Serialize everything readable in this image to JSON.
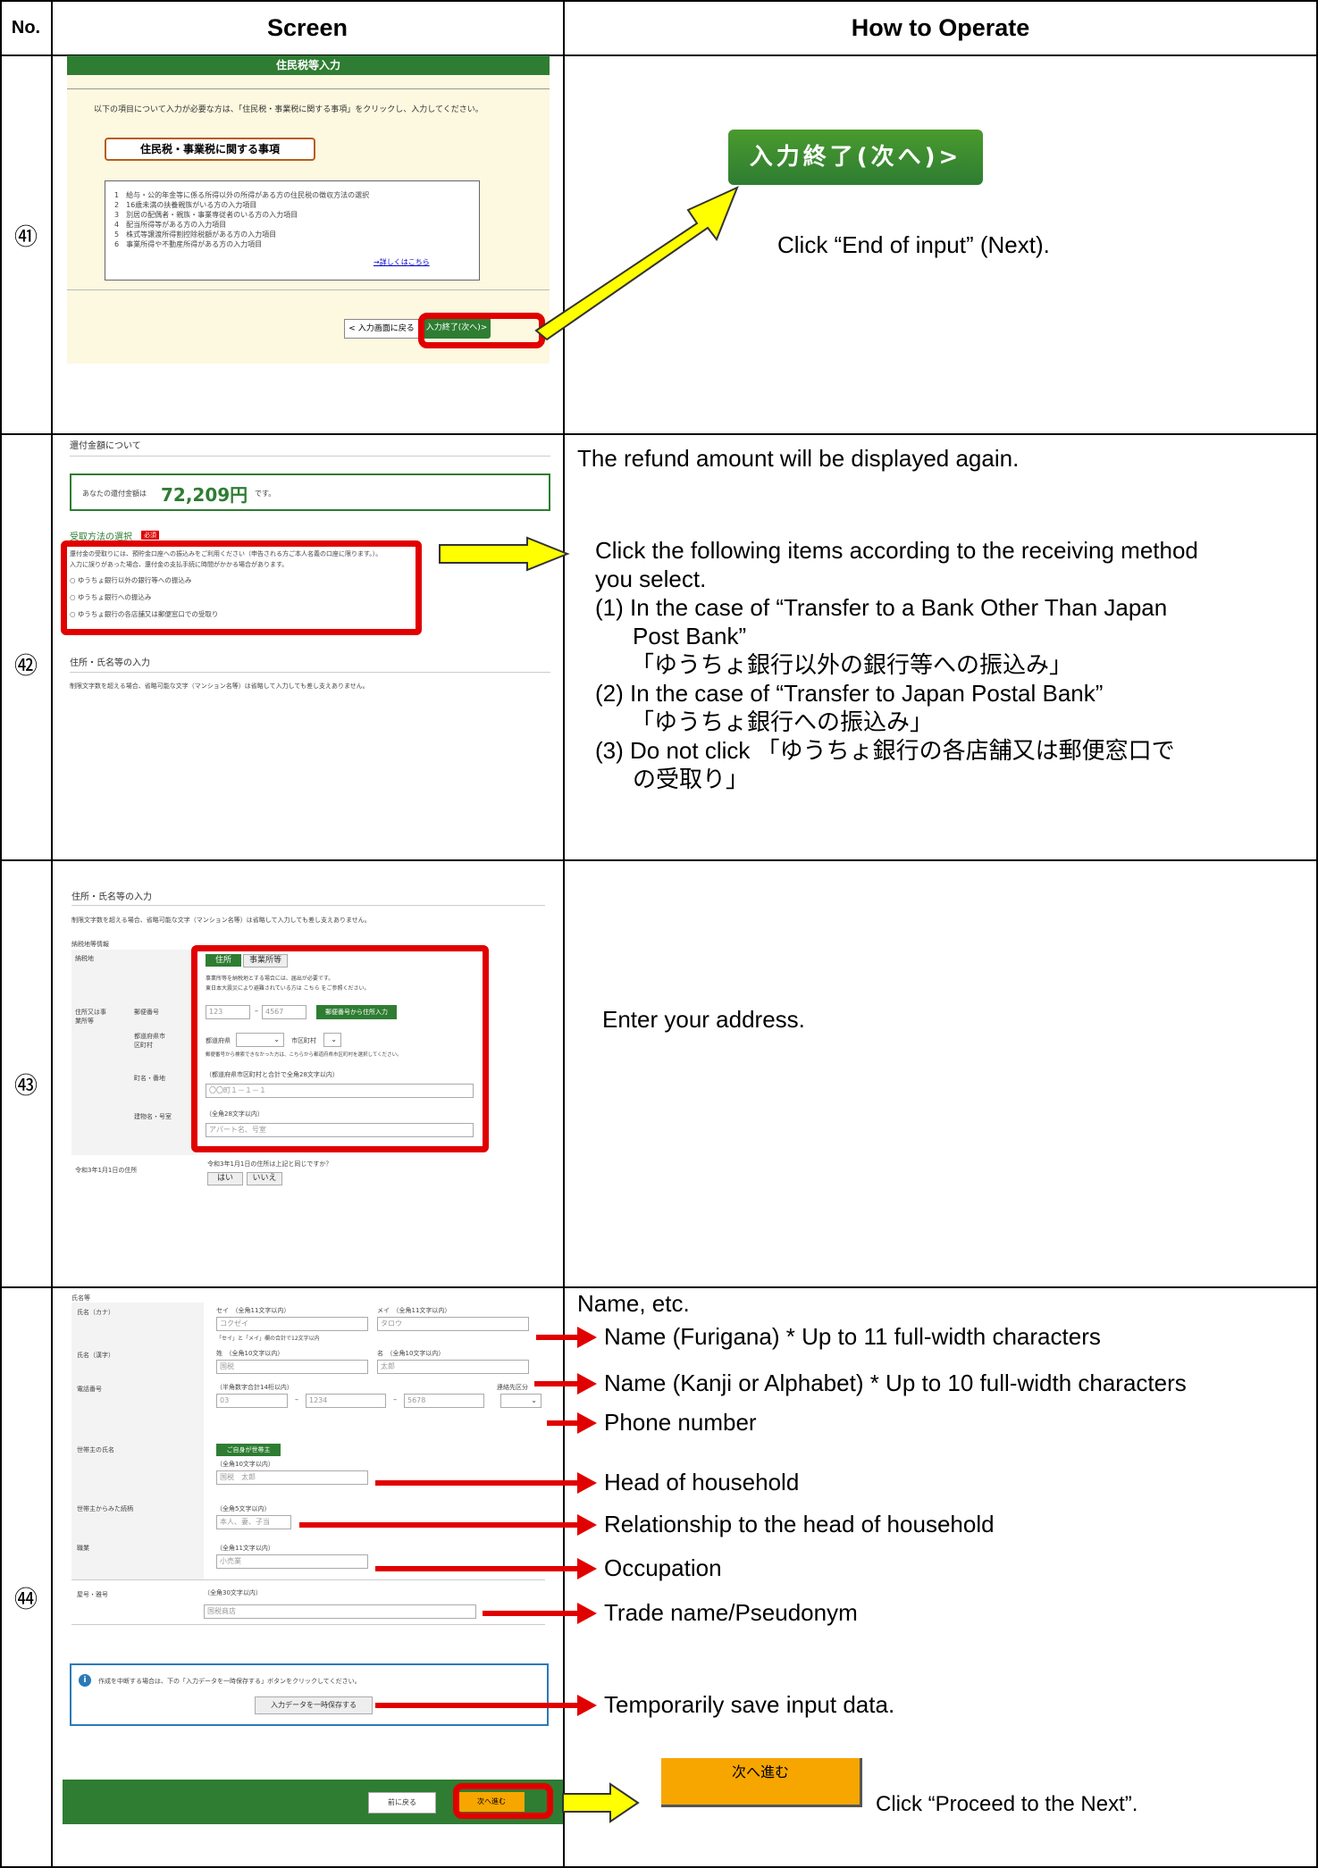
{
  "header": {
    "no": "No.",
    "screen": "Screen",
    "how": "How to Operate"
  },
  "rows": [
    {
      "num": "㊶"
    },
    {
      "num": "㊷"
    },
    {
      "num": "㊸"
    },
    {
      "num": "㊹"
    }
  ],
  "r41": {
    "title": "住民税等入力",
    "intro": "以下の項目について入力が必要な方は、「住民税・事業税に関する事項」をクリックし、入力してください。",
    "section_btn": "住民税・事業税に関する事項",
    "items": [
      "1　給与・公的年金等に係る所得以外の所得がある方の住民税の徴収方法の選択",
      "2　16歳未満の扶養親族がいる方の入力項目",
      "3　別居の配偶者・親族・事業専従者のいる方の入力項目",
      "4　配当所得等がある方の入力項目",
      "5　株式等譲渡所得割控除税額がある方の入力項目",
      "6　事業所得や不動産所得がある方の入力項目"
    ],
    "details_link": "→詳しくはこちら",
    "back_btn": "< 入力画面に戻る",
    "end_btn_small": "入力終了(次へ)>",
    "end_btn_big": "入力終了(次へ)>",
    "op_text": "Click “End of input” (Next)."
  },
  "r42": {
    "refund_head": "還付金額について",
    "refund_prefix": "あなたの還付金額は",
    "refund_amount": "72,209円",
    "refund_suffix": "です。",
    "method_head": "受取方法の選択",
    "required": "必須",
    "method_note1": "還付金の受取りには、預貯金口座への振込みをご利用ください（申告される方ご本人名義の口座に限ります。）。",
    "method_note2": "入力に誤りがあった場合、還付金の支払手続に時間がかかる場合があります。",
    "opt1": "○ ゆうちょ銀行以外の銀行等への振込み",
    "opt2": "○ ゆうちょ銀行への振込み",
    "opt3": "○ ゆうちょ銀行の各店舗又は郵便窓口での受取り",
    "addr_head": "住所・氏名等の入力",
    "addr_note": "制限文字数を超える場合、省略可能な文字（マンション名等）は省略して入力しても差し支えありません。",
    "op_line1": "The refund amount will be displayed again.",
    "op_para": "Click the following items according to the receiving method you select.",
    "op_1a": "(1) In the case of “Transfer to a Bank Other Than Japan",
    "op_1b": "Post Bank”",
    "op_1c": "「ゆうちょ銀行以外の銀行等への振込み」",
    "op_2a": "(2) In the case of “Transfer to Japan Postal Bank”",
    "op_2b": "「ゆうちょ銀行への振込み」",
    "op_3a": "(3) Do not click 「ゆうちょ銀行の各店舗又は郵便窓口で",
    "op_3b": "の受取り」"
  },
  "r43": {
    "head": "住所・氏名等の入力",
    "note": "制限文字数を超える場合、省略可能な文字（マンション名等）は省略して入力しても差し支えありません。",
    "sub": "納税地等情報",
    "lbl_nozeichi": "納税地",
    "tab_address": "住所",
    "tab_office": "事業所等",
    "note_a": "事業所等を納税地とする場合には、届出が必要です。",
    "note_b": "東日本大震災により避難されている方は こちら をご参照ください。",
    "lbl_addr": "住所又は事業所等",
    "lbl_postal": "郵便番号",
    "postal1": "123",
    "postal2": "4567",
    "postal_btn": "郵便番号から住所入力",
    "lbl_pref": "都道府県市区町村",
    "pref_label": "都道府県",
    "city_label": "市区町村",
    "pref_note": "郵便番号から検索できなかった方は、こちらから都道府県市区町村を選択してください。",
    "lbl_town": "町名・番地",
    "town_hint": "（都道府県市区町村と合計で全角28文字以内）",
    "town_ph": "〇〇町１－１－１",
    "lbl_bldg": "建物名・号室",
    "bldg_hint": "（全角28文字以内）",
    "bldg_ph": "アパート名、号室",
    "lbl_jan1": "令和3年1月1日の住所",
    "jan1_q": "令和3年1月1日の住所は上記と同じですか？",
    "yes": "はい",
    "no": "いいえ",
    "op_text": "Enter your address."
  },
  "r44": {
    "sub": "氏名等",
    "lbl_kana": "氏名（カナ）",
    "sei_hint": "セイ　（全角11文字以内）",
    "mei_hint": "メイ　（全角11文字以内）",
    "sei_val": "コクゼイ",
    "mei_val": "タロウ",
    "kana_note": "「セイ」と「メイ」欄の合計で12文字以内",
    "lbl_kanji": "氏名（漢字）",
    "sei_k_hint": "姓　（全角10文字以内）",
    "mei_k_hint": "名　（全角10文字以内）",
    "sei_k_val": "国税",
    "mei_k_val": "太郎",
    "lbl_phone": "電話番号",
    "phone_hint": "（半角数字合計14桁以内）",
    "phone_type": "連絡先区分",
    "ph1": "03",
    "ph2": "1234",
    "ph3": "5678",
    "lbl_head": "世帯主の氏名",
    "head_btn": "ご自身が世帯主",
    "head_hint": "（全角10文字以内）",
    "head_val": "国税　太郎",
    "lbl_rel": "世帯主からみた続柄",
    "rel_hint": "（全角5文字以内）",
    "rel_val": "本人、妻、子当",
    "lbl_occ": "職業",
    "occ_hint": "（全角11文字以内）",
    "occ_val": "小売業",
    "lbl_trade": "屋号・雅号",
    "trade_hint": "（全角30文字以内）",
    "trade_val": "国税商店",
    "info_text": "作成を中断する場合は、下の「入力データを一時保存する」ボタンをクリックしてください。",
    "save_btn": "入力データを一時保存する",
    "back_btn": "前に戻る",
    "next_btn": "次へ進む",
    "big_next": "次へ進む",
    "op_title": "Name, etc.",
    "op_kana": "Name (Furigana) * Up to 11 full-width characters",
    "op_kanji": "Name (Kanji or Alphabet) * Up to 10 full-width characters",
    "op_phone": "Phone number",
    "op_head": "Head of household",
    "op_rel": "Relationship to the head of household",
    "op_occ": "Occupation",
    "op_trade": "Trade name/Pseudonym",
    "op_save": "Temporarily save input data.",
    "op_next": "Click “Proceed to the Next”."
  },
  "colors": {
    "green": "#2e7d32",
    "red": "#e10000",
    "yellow": "#ffff00",
    "orange": "#f7a600",
    "cream": "#fdf8e0"
  }
}
